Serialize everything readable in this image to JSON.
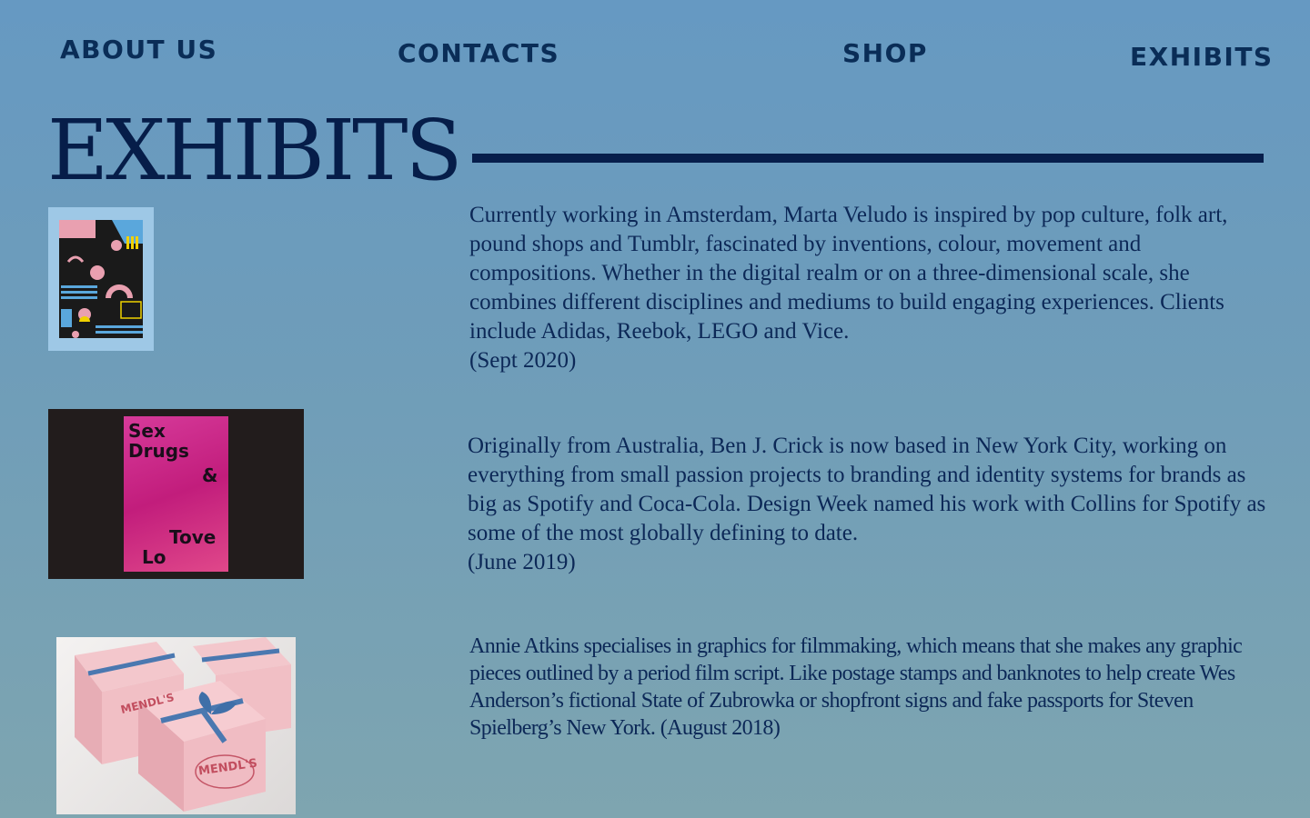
{
  "nav": {
    "items": [
      {
        "label": "ABOUT US"
      },
      {
        "label": "CONTACTS"
      },
      {
        "label": "SHOP"
      },
      {
        "label": "EXHIBITS"
      }
    ]
  },
  "page": {
    "title": "EXHIBITS"
  },
  "exhibits": [
    {
      "image_alt": "Colorful geometric poster artwork",
      "description": "Currently working in Amsterdam, Marta Veludo is inspired by pop culture, folk art, pound shops and Tumblr, fascinated by inventions, colour, movement and compositions. Whether in the digital realm or on a three-dimensional scale, she combines different disciplines and mediums to build engaging experiences. Clients include Adidas, Reebok, LEGO and Vice.",
      "date": "(Sept 2020)"
    },
    {
      "image_alt": "Sex Drugs & Tove Lo poster",
      "poster_text": [
        "Sex",
        "Drugs",
        "&",
        "Tove",
        "Lo"
      ],
      "description": "Originally from Australia, Ben J. Crick is now based in New York City, working on everything from small passion projects to branding and identity systems for brands as big as Spotify and Coca-Cola. Design Week named his work with Collins for Spotify as some of the most globally defining to date.",
      "date": "(June 2019)"
    },
    {
      "image_alt": "Pink Mendl's pastry boxes tied with blue ribbon",
      "box_text": "MENDL'S",
      "description": "Annie Atkins specialises in graphics for filmmaking, which means that she makes any graphic pieces outlined by a period film script. Like postage stamps and banknotes to help create Wes Anderson’s fictional State of Zubrowka or shopfront signs and fake passports for Steven Spielberg’s New York. (August 2018)"
    }
  ],
  "colors": {
    "background_top": "#6699c2",
    "background_bottom": "#7ea5b0",
    "heading": "#061d49",
    "nav_text": "#0a2d57",
    "body_text": "#0c2857",
    "rule": "#071e4b"
  }
}
